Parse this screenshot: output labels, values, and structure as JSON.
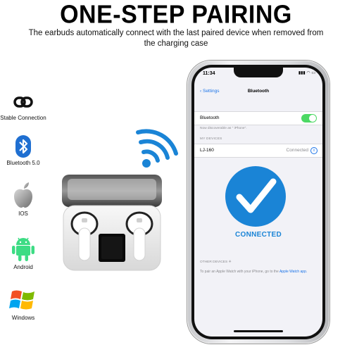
{
  "header": {
    "title": "ONE-STEP PAIRING",
    "subtitle_line1": "The earbuds automatically connect with the last paired device when removed from",
    "subtitle_line2": "the charging case"
  },
  "features": [
    {
      "label": "Stable Connection",
      "icon": "link-icon"
    },
    {
      "label": "Bluetooth 5.0",
      "icon": "bluetooth-icon"
    },
    {
      "label": "IOS",
      "icon": "apple-icon"
    },
    {
      "label": "Android",
      "icon": "android-icon"
    },
    {
      "label": "Windows",
      "icon": "windows-icon"
    }
  ],
  "phone": {
    "status_time": "11:34",
    "nav_back": "Settings",
    "nav_title": "Bluetooth",
    "bluetooth_label": "Bluetooth",
    "discoverable_note": "Now discoverable as \" iPhone\".",
    "my_devices_header": "MY DEVICES",
    "device_name": "LJ-160",
    "device_status": "Connected",
    "connected_banner": "CONNECTED",
    "other_devices_header": "OTHER DEVICES",
    "pair_note": "To pair an Apple Watch with your iPhone, go to the",
    "pair_link": "Apple Watch app."
  },
  "colors": {
    "accent_blue": "#1a84d6",
    "toggle_green": "#4cd964",
    "link_blue": "#1a73e8"
  }
}
